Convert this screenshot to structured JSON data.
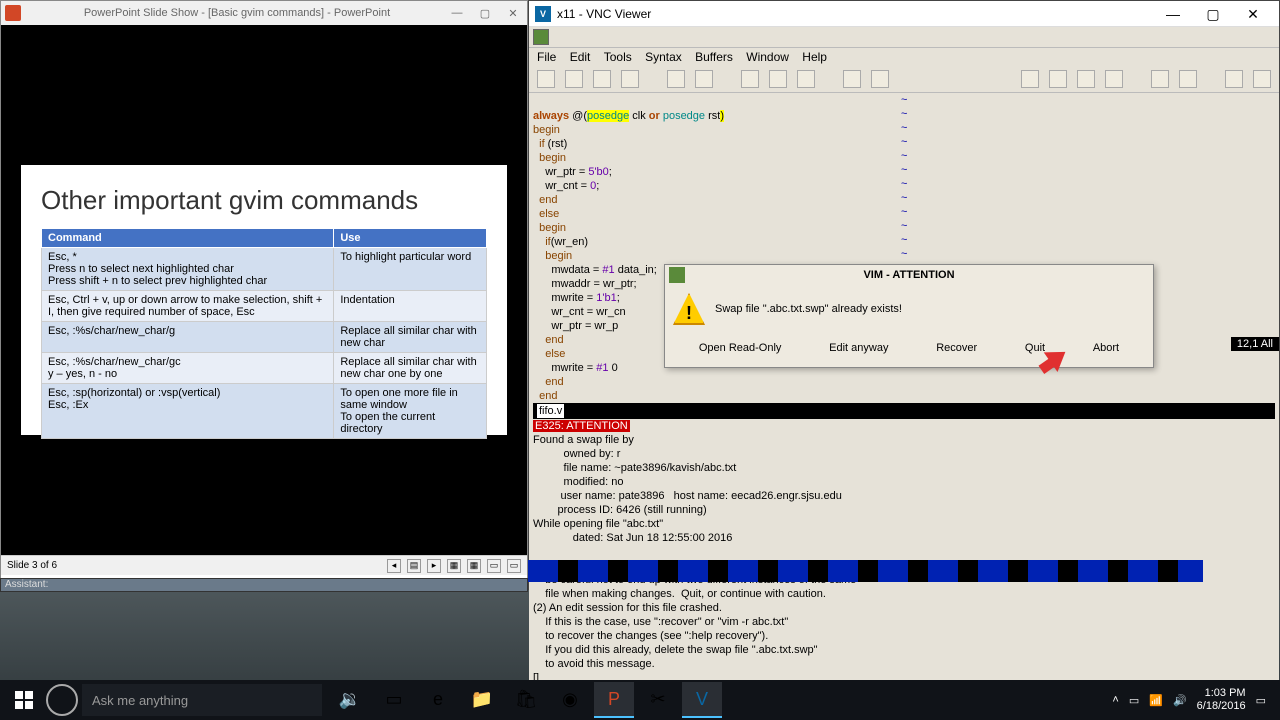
{
  "powerpoint": {
    "title": "PowerPoint Slide Show - [Basic gvim commands] - PowerPoint",
    "slide_title": "Other important gvim commands",
    "headers": [
      "Command",
      "Use"
    ],
    "rows": [
      [
        "Esc, *\nPress n to select next highlighted char\nPress shift + n to select prev highlighted char",
        "To highlight particular word"
      ],
      [
        "Esc, Ctrl + v, up or down arrow to make selection, shift + I, then give required number of space, Esc",
        "Indentation"
      ],
      [
        "Esc, :%s/char/new_char/g",
        "Replace all similar char with new char"
      ],
      [
        "Esc, :%s/char/new_char/gc\ny – yes, n - no",
        "Replace all similar char with new char one by one"
      ],
      [
        "Esc, :sp(horizontal) or :vsp(vertical)\nEsc, :Ex",
        "To open one more file in same window\nTo open the current directory"
      ]
    ],
    "status_left": "Slide 3 of 6",
    "assistant": "Assistant:"
  },
  "vnc": {
    "title": "x11 - VNC Viewer",
    "menus": [
      "File",
      "Edit",
      "Tools",
      "Syntax",
      "Buffers",
      "Window",
      "Help"
    ],
    "code_lines": [
      {
        "t": "always @(posedge clk or posedge rst)",
        "cls": ""
      },
      {
        "t": "begin",
        "cls": "kw-brown"
      },
      {
        "t": "  if (rst)",
        "cls": ""
      },
      {
        "t": "  begin",
        "cls": "kw-brown"
      },
      {
        "t": "    wr_ptr = 5'b0;",
        "cls": ""
      },
      {
        "t": "    wr_cnt = 0;",
        "cls": ""
      },
      {
        "t": "  end",
        "cls": "kw-brown"
      },
      {
        "t": "  else",
        "cls": "kw-brown"
      },
      {
        "t": "  begin",
        "cls": "kw-brown"
      },
      {
        "t": "    if(wr_en)",
        "cls": ""
      },
      {
        "t": "    begin",
        "cls": "kw-brown"
      },
      {
        "t": "      mwdata = #1 data_in;",
        "cls": ""
      },
      {
        "t": "      mwaddr = wr_ptr;",
        "cls": ""
      },
      {
        "t": "      mwrite = 1'b1;",
        "cls": ""
      },
      {
        "t": "      wr_cnt = wr_cnt + 1;",
        "cls": ""
      },
      {
        "t": "      wr_ptr = wr_p",
        "cls": ""
      },
      {
        "t": "    end",
        "cls": "kw-brown"
      },
      {
        "t": "    else",
        "cls": "kw-brown"
      },
      {
        "t": "      mwrite = #1 0",
        "cls": ""
      },
      {
        "t": "    end",
        "cls": "kw-brown"
      },
      {
        "t": "  end",
        "cls": "kw-brown"
      }
    ],
    "filename": "fifo.v",
    "e325": "E325: ATTENTION",
    "swap_block": "Found a swap file by\n          owned by: r\n          file name: ~pate3896/kavish/abc.txt\n          modified: no\n         user name: pate3896   host name: eecad26.engr.sjsu.edu\n        process ID: 6426 (still running)\nWhile opening file \"abc.txt\"\n             dated: Sat Jun 18 12:55:00 2016\n\n(1) Another program may be editing the same file.  If this is the case,\n    be careful not to end up with two different instances of the same\n    file when making changes.  Quit, or continue with caution.\n(2) An edit session for this file crashed.\n    If this is the case, use \":recover\" or \"vim -r abc.txt\"\n    to recover the changes (see \":help recovery\").\n    If you did this already, delete the swap file \".abc.txt.swp\"\n    to avoid this message.\n[]",
    "ruler": "12,1          All",
    "dialog": {
      "title": "VIM - ATTENTION",
      "message": "Swap file \".abc.txt.swp\" already exists!",
      "buttons": [
        "Open Read-Only",
        "Edit anyway",
        "Recover",
        "Quit",
        "Abort"
      ]
    }
  },
  "taskbar": {
    "search_placeholder": "Ask me anything",
    "time": "1:03 PM",
    "date": "6/18/2016"
  }
}
